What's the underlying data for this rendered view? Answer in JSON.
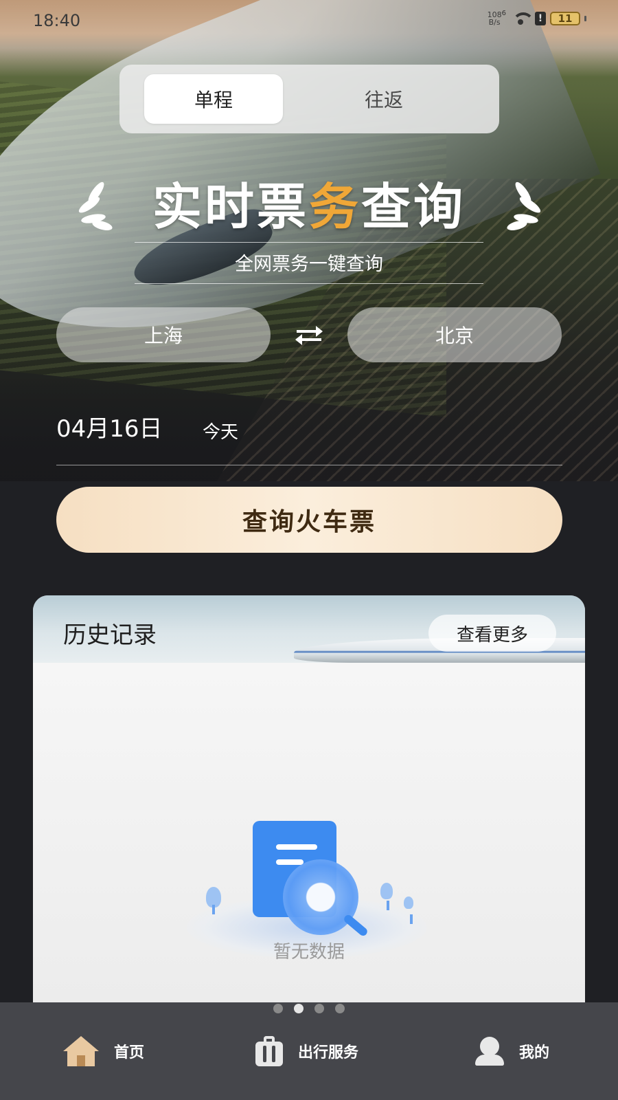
{
  "status_bar": {
    "time": "18:40",
    "net_speed_value": "108",
    "net_speed_unit": "B/s",
    "signal_label": "6",
    "battery": "11"
  },
  "trip_type": {
    "options": [
      "单程",
      "往返"
    ],
    "selected": "单程"
  },
  "banner": {
    "title_part1": "实时票",
    "title_highlight": "务",
    "title_part2": "查询",
    "subtitle": "全网票务一键查询"
  },
  "route": {
    "from": "上海",
    "to": "北京"
  },
  "travel_date": {
    "date": "04月16日",
    "day": "今天"
  },
  "search_button": "查询火车票",
  "history": {
    "title": "历史记录",
    "more": "查看更多",
    "empty_text": "暂无数据"
  },
  "pager": {
    "count": 4,
    "active_index": 1
  },
  "bottom_nav": {
    "items": [
      {
        "label": "首页",
        "icon": "home-icon"
      },
      {
        "label": "出行服务",
        "icon": "luggage-icon"
      },
      {
        "label": "我的",
        "icon": "user-icon"
      }
    ]
  },
  "colors": {
    "title_highlight": "#f0a737",
    "search_button_bg": "#f6dfc2",
    "search_button_text": "#3f2a12",
    "nav_bg": "#45464b",
    "empty_icon_blue": "#3d8bf0"
  }
}
